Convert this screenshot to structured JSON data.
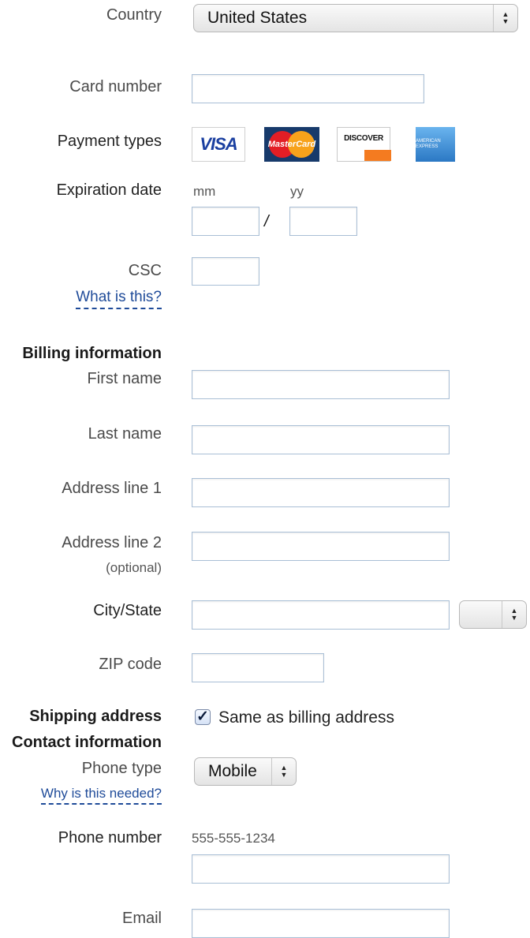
{
  "country": {
    "label": "Country",
    "value": "United States"
  },
  "card_number": {
    "label": "Card number",
    "value": ""
  },
  "payment_types": {
    "label": "Payment types",
    "cards": [
      {
        "name": "visa",
        "text": "VISA"
      },
      {
        "name": "mastercard",
        "text": "MasterCard"
      },
      {
        "name": "discover",
        "text": "DISCOVER"
      },
      {
        "name": "amex",
        "text": "AMERICAN EXPRESS"
      }
    ]
  },
  "expiration": {
    "label": "Expiration date",
    "mm_hint": "mm",
    "yy_hint": "yy",
    "separator": "/"
  },
  "csc": {
    "label": "CSC",
    "help_link": "What is this?"
  },
  "billing": {
    "heading": "Billing information",
    "first_name": "First name",
    "last_name": "Last name",
    "address1": "Address line 1",
    "address2": "Address line 2",
    "address2_note": "(optional)",
    "city_state": "City/State",
    "state_value": "",
    "zip": "ZIP code"
  },
  "shipping": {
    "heading": "Shipping address",
    "same_as_billing": "Same as billing address",
    "checked": true
  },
  "contact": {
    "heading": "Contact information",
    "phone_type_label": "Phone type",
    "phone_type_value": "Mobile",
    "why_link": "Why is this needed?",
    "phone_number_label": "Phone number",
    "phone_placeholder": "555-555-1234",
    "email_label": "Email"
  }
}
